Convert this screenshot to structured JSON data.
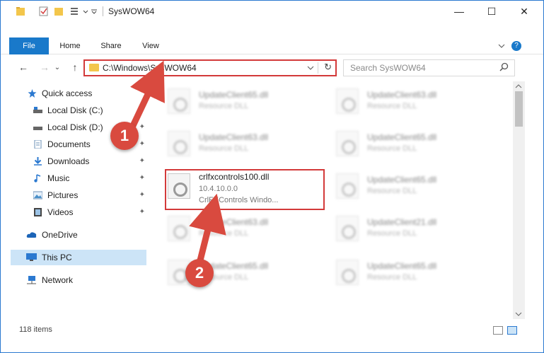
{
  "window": {
    "title": "SysWOW64",
    "minimize": "—",
    "maximize": "☐",
    "close": "✕"
  },
  "ribbon": {
    "tabs": [
      "File",
      "Home",
      "Share",
      "View"
    ],
    "expand_icon": "chevron-down-icon",
    "help": "?"
  },
  "navigation": {
    "back": "←",
    "forward": "→",
    "recent": "⌄",
    "up": "↑",
    "address_path": "C:\\Windows\\SysWOW64",
    "refresh": "↻",
    "search_placeholder": "Search SysWOW64"
  },
  "sidebar": {
    "items": [
      {
        "label": "Quick access",
        "icon": "star-icon",
        "pinned": false
      },
      {
        "label": "Local Disk (C:)",
        "icon": "drive-icon",
        "pinned": false
      },
      {
        "label": "Local Disk (D:)",
        "icon": "drive-icon",
        "pinned": true
      },
      {
        "label": "Documents",
        "icon": "documents-icon",
        "pinned": true
      },
      {
        "label": "Downloads",
        "icon": "download-icon",
        "pinned": true
      },
      {
        "label": "Music",
        "icon": "music-icon",
        "pinned": true
      },
      {
        "label": "Pictures",
        "icon": "pictures-icon",
        "pinned": true
      },
      {
        "label": "Videos",
        "icon": "videos-icon",
        "pinned": true
      },
      {
        "label": "OneDrive",
        "icon": "cloud-icon",
        "pinned": false
      },
      {
        "label": "This PC",
        "icon": "computer-icon",
        "pinned": false,
        "selected": true
      },
      {
        "label": "Network",
        "icon": "network-icon",
        "pinned": false
      }
    ],
    "pin_glyph": "📌"
  },
  "files": [
    {
      "name": "UpdateClient65.dll",
      "sub": "Resource DLL",
      "blurred": true
    },
    {
      "name": "UpdateClient63.dll",
      "sub": "Resource DLL",
      "blurred": true
    },
    {
      "name": "UpdateClient63.dll",
      "sub": "Resource DLL",
      "blurred": true
    },
    {
      "name": "UpdateClient65.dll",
      "sub": "Resource DLL",
      "blurred": true
    },
    {
      "name": "crlfxcontrols100.dll",
      "sub": "10.4.10.0.0",
      "sub2": "CrlFXControls Windo...",
      "blurred": false
    },
    {
      "name": "UpdateClient65.dll",
      "sub": "Resource DLL",
      "blurred": true
    },
    {
      "name": "UpdateClient63.dll",
      "sub": "Resource DLL",
      "blurred": true
    },
    {
      "name": "UpdateClient21.dll",
      "sub": "Resource DLL",
      "blurred": true
    },
    {
      "name": "UpdateClient65.dll",
      "sub": "Resource DLL",
      "blurred": true
    },
    {
      "name": "UpdateClient65.dll",
      "sub": "Resource DLL",
      "blurred": true
    }
  ],
  "status": {
    "item_count": "118 items"
  },
  "annotations": {
    "step1": "1",
    "step2": "2"
  },
  "colors": {
    "accent": "#1979ca",
    "highlight_red": "#d33a3a",
    "badge_red": "#d94a3f",
    "selection": "#cce4f7",
    "folder_yellow": "#f3c64b"
  }
}
